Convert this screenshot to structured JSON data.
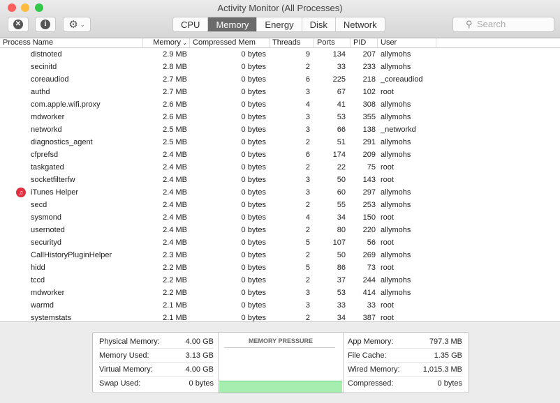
{
  "window": {
    "title": "Activity Monitor (All Processes)"
  },
  "toolbar": {
    "tabs": [
      "CPU",
      "Memory",
      "Energy",
      "Disk",
      "Network"
    ],
    "active_tab": "Memory",
    "search_placeholder": "Search"
  },
  "columns": [
    "Process Name",
    "Memory",
    "Compressed Mem",
    "Threads",
    "Ports",
    "PID",
    "User"
  ],
  "rows": [
    [
      "distnoted",
      "2.9 MB",
      "0 bytes",
      "9",
      "134",
      "207",
      "allymohs"
    ],
    [
      "secinitd",
      "2.8 MB",
      "0 bytes",
      "2",
      "33",
      "233",
      "allymohs"
    ],
    [
      "coreaudiod",
      "2.7 MB",
      "0 bytes",
      "6",
      "225",
      "218",
      "_coreaudiod"
    ],
    [
      "authd",
      "2.7 MB",
      "0 bytes",
      "3",
      "67",
      "102",
      "root"
    ],
    [
      "com.apple.wifi.proxy",
      "2.6 MB",
      "0 bytes",
      "4",
      "41",
      "308",
      "allymohs"
    ],
    [
      "mdworker",
      "2.6 MB",
      "0 bytes",
      "3",
      "53",
      "355",
      "allymohs"
    ],
    [
      "networkd",
      "2.5 MB",
      "0 bytes",
      "3",
      "66",
      "138",
      "_networkd"
    ],
    [
      "diagnostics_agent",
      "2.5 MB",
      "0 bytes",
      "2",
      "51",
      "291",
      "allymohs"
    ],
    [
      "cfprefsd",
      "2.4 MB",
      "0 bytes",
      "6",
      "174",
      "209",
      "allymohs"
    ],
    [
      "taskgated",
      "2.4 MB",
      "0 bytes",
      "2",
      "22",
      "75",
      "root"
    ],
    [
      "socketfilterfw",
      "2.4 MB",
      "0 bytes",
      "3",
      "50",
      "143",
      "root"
    ],
    [
      "iTunes Helper",
      "2.4 MB",
      "0 bytes",
      "3",
      "60",
      "297",
      "allymohs"
    ],
    [
      "secd",
      "2.4 MB",
      "0 bytes",
      "2",
      "55",
      "253",
      "allymohs"
    ],
    [
      "sysmond",
      "2.4 MB",
      "0 bytes",
      "4",
      "34",
      "150",
      "root"
    ],
    [
      "usernoted",
      "2.4 MB",
      "0 bytes",
      "2",
      "80",
      "220",
      "allymohs"
    ],
    [
      "securityd",
      "2.4 MB",
      "0 bytes",
      "5",
      "107",
      "56",
      "root"
    ],
    [
      "CallHistoryPluginHelper",
      "2.3 MB",
      "0 bytes",
      "2",
      "50",
      "269",
      "allymohs"
    ],
    [
      "hidd",
      "2.2 MB",
      "0 bytes",
      "5",
      "86",
      "73",
      "root"
    ],
    [
      "tccd",
      "2.2 MB",
      "0 bytes",
      "2",
      "37",
      "244",
      "allymohs"
    ],
    [
      "mdworker",
      "2.2 MB",
      "0 bytes",
      "3",
      "53",
      "414",
      "allymohs"
    ],
    [
      "warmd",
      "2.1 MB",
      "0 bytes",
      "3",
      "33",
      "33",
      "root"
    ],
    [
      "systemstats",
      "2.1 MB",
      "0 bytes",
      "2",
      "34",
      "387",
      "root"
    ]
  ],
  "summary": {
    "left": [
      {
        "k": "Physical Memory:",
        "v": "4.00 GB"
      },
      {
        "k": "Memory Used:",
        "v": "3.13 GB"
      },
      {
        "k": "Virtual Memory:",
        "v": "4.00 GB"
      },
      {
        "k": "Swap Used:",
        "v": "0 bytes"
      }
    ],
    "pressure_title": "MEMORY PRESSURE",
    "pressure_color": "#a6eeb0",
    "right": [
      {
        "k": "App Memory:",
        "v": "797.3 MB"
      },
      {
        "k": "File Cache:",
        "v": "1.35 GB"
      },
      {
        "k": "Wired Memory:",
        "v": "1,015.3 MB"
      },
      {
        "k": "Compressed:",
        "v": "0 bytes"
      }
    ]
  }
}
